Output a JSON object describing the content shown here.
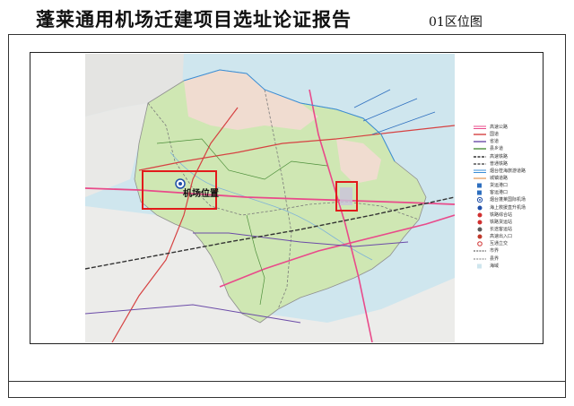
{
  "header": {
    "title": "蓬莱通用机场迁建项目选址论证报告",
    "figure_label": "01区位图"
  },
  "map": {
    "site_label": "机场位置",
    "highlight_color": "#e21b1b",
    "sea_color": "#cfe6ee",
    "land_color": "#cfe7b3",
    "urban_color": "#f0dcd0"
  },
  "legend": {
    "items": [
      {
        "label": "高速公路",
        "color": "#e94a8a",
        "icon": "double-line"
      },
      {
        "label": "国道",
        "color": "#d64242",
        "icon": "line"
      },
      {
        "label": "省道",
        "color": "#6b4ba8",
        "icon": "line"
      },
      {
        "label": "县乡道",
        "color": "#4d8f3a",
        "icon": "line"
      },
      {
        "label": "高速铁路",
        "color": "#333333",
        "icon": "rail"
      },
      {
        "label": "普通铁路",
        "color": "#555555",
        "icon": "rail"
      },
      {
        "label": "烟台莅海旅游道路",
        "color": "#3a8ed6",
        "icon": "double-line"
      },
      {
        "label": "城镇道路",
        "color": "#e8a46a",
        "icon": "line"
      },
      {
        "label": "货运港口",
        "color": "#2e6fbf",
        "icon": "square"
      },
      {
        "label": "客运港口",
        "color": "#2e6fbf",
        "icon": "square"
      },
      {
        "label": "烟台蓬莱国际机场",
        "color": "#1f4fa8",
        "icon": "plane-circle"
      },
      {
        "label": "海上救援直升机场",
        "color": "#1f4fa8",
        "icon": "circle"
      },
      {
        "label": "铁路综合站",
        "color": "#d03030",
        "icon": "circle"
      },
      {
        "label": "铁路货运站",
        "color": "#d03030",
        "icon": "circle"
      },
      {
        "label": "长途客运站",
        "color": "#5a5a5a",
        "icon": "circle"
      },
      {
        "label": "高速出入口",
        "color": "#c0392b",
        "icon": "circle"
      },
      {
        "label": "互通立交",
        "color": "#d03030",
        "icon": "ring"
      },
      {
        "label": "市界",
        "color": "#444444",
        "icon": "dash"
      },
      {
        "label": "县界",
        "color": "#777777",
        "icon": "dash"
      },
      {
        "label": "海域",
        "color": "#cfe6ee",
        "icon": "square"
      }
    ]
  }
}
